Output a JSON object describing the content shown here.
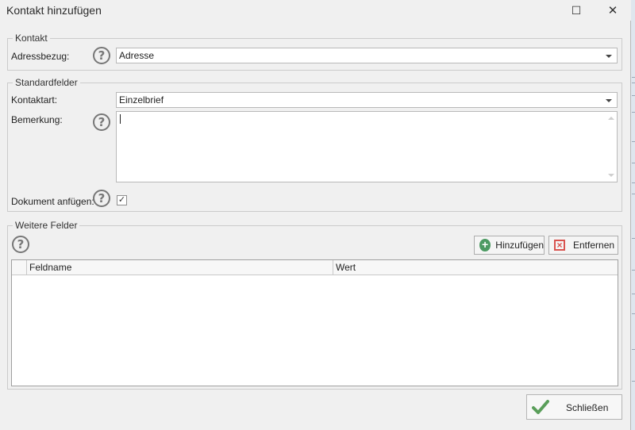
{
  "window": {
    "title": "Kontakt hinzufügen",
    "maximize_glyph": "☐",
    "close_glyph": "✕"
  },
  "kontakt": {
    "legend": "Kontakt",
    "adressbezug_label": "Adressbezug:",
    "adressbezug_value": "Adresse"
  },
  "standardfelder": {
    "legend": "Standardfelder",
    "kontaktart_label": "Kontaktart:",
    "kontaktart_value": "Einzelbrief",
    "bemerkung_label": "Bemerkung:",
    "bemerkung_value": "",
    "dokument_label": "Dokument anfügen:",
    "dokument_checked": true
  },
  "weitere_felder": {
    "legend": "Weitere Felder",
    "add_label": "Hinzufügen",
    "remove_label": "Entfernen",
    "columns": [
      "Feldname",
      "Wert"
    ],
    "rows": []
  },
  "footer": {
    "close_label": "Schließen"
  },
  "icons": {
    "help": "help-icon",
    "add": "plus-circle-icon",
    "remove": "remove-square-icon",
    "close": "checkmark-icon"
  },
  "colors": {
    "add_green": "#4c9a62",
    "remove_red": "#d9534f",
    "check_green": "#5a9e5a"
  }
}
